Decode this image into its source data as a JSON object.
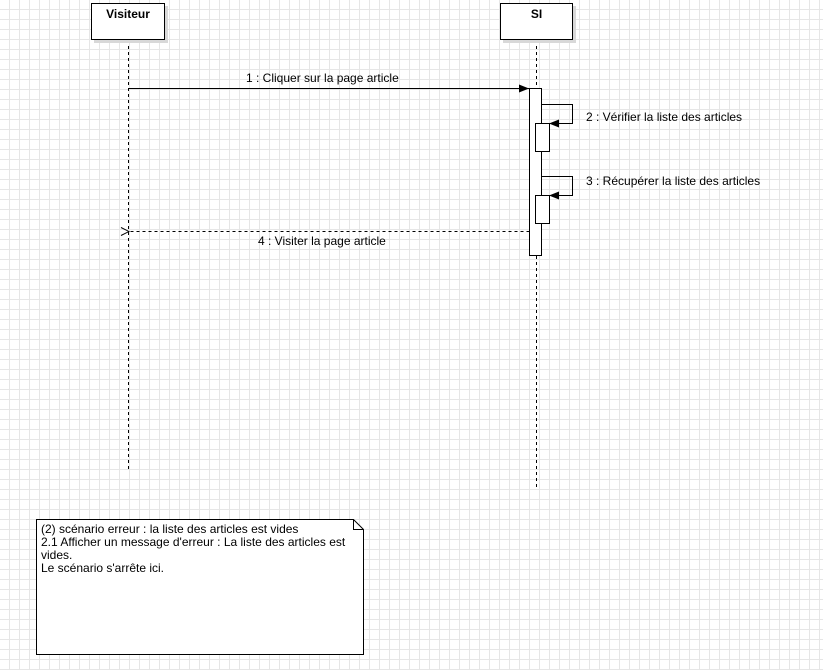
{
  "participants": {
    "visiteur": "Visiteur",
    "si": "SI"
  },
  "messages": {
    "m1": "1 : Cliquer sur la page article",
    "m2": "2 : Vérifier la liste des articles",
    "m3": "3 : Récupérer la liste des articles",
    "m4": "4 : Visiter la page article"
  },
  "note": {
    "line1": "(2) scénario erreur : la liste des articles est vides",
    "line2": "2.1 Afficher un message d'erreur : La liste des articles est vides.",
    "line3": "Le scénario s'arrête ici."
  }
}
